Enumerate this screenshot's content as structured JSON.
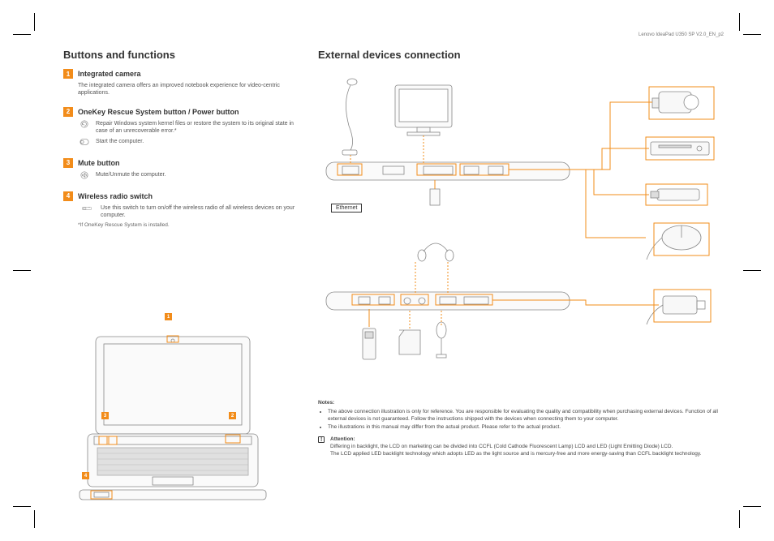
{
  "header": {
    "doc_id": "Lenovo IdeaPad U350 SP V2.0_EN_p2"
  },
  "left": {
    "heading": "Buttons and functions",
    "items": [
      {
        "num": "1",
        "title": "Integrated camera",
        "desc": "The integrated camera offers an improved notebook experience for video-centric applications."
      },
      {
        "num": "2",
        "title": "OneKey Rescue System button / Power button",
        "rows": [
          {
            "icon": "recovery",
            "text": "Repair Windows system kernel files or restore the system to its original state in case of an unrecoverable error.*"
          },
          {
            "icon": "power",
            "text": "Start the computer."
          }
        ]
      },
      {
        "num": "3",
        "title": "Mute button",
        "rows": [
          {
            "icon": "mute",
            "text": "Mute/Unmute the computer."
          }
        ]
      },
      {
        "num": "4",
        "title": "Wireless radio switch",
        "rows": [
          {
            "icon": "switch",
            "text": "Use this switch to turn on/off the wireless radio of all wireless devices on your computer."
          }
        ]
      }
    ],
    "footnote": "*If OneKey Rescue System is installed."
  },
  "right": {
    "heading": "External devices connection",
    "ethernet_label": "Ethernet",
    "notes_head": "Notes:",
    "notes": [
      "The above connection illustration is only for reference. You are responsible for evaluating the quality and compatibility when purchasing external devices. Function of all external devices is not guaranteed. Follow the instructions shipped with the devices when connecting them to your computer.",
      "The illustrations in this manual may differ from the actual product. Please refer to the actual product."
    ],
    "attention_head": "Attention:",
    "attention": [
      "Differing in backlight, the LCD on marketing can be divided into CCFL (Cold Cathode Fluorescent Lamp) LCD and LED (Light Emitting Diode) LCD.",
      "The LCD applied LED backlight technology which adopts LED as the light source and is mercury-free and more energy-saving than CCFL backlight technology."
    ]
  }
}
